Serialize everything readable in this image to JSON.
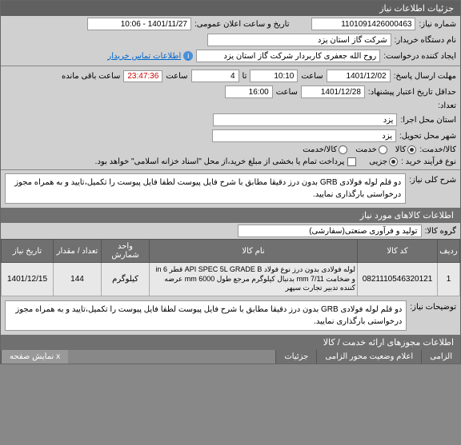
{
  "panel_title": "جزئیات اطلاعات نیاز",
  "labels": {
    "need_no": "شماره نیاز:",
    "announce": "تاریخ و ساعت اعلان عمومی:",
    "buyer": "نام دستگاه خریدار:",
    "requester": "ایجاد کننده درخواست:",
    "contact": "اطلاعات تماس خریدار",
    "deadline": "مهلت ارسال پاسخ:",
    "time_lbl": "ساعت",
    "until": "تا",
    "remaining": "ساعت باقی مانده",
    "min_credit": "حداقل تاریخ اعتبار پیشنهاد:",
    "price": "تعداد:",
    "exec_province": "استان محل اجرا:",
    "delivery_city": "شهر محل تحویل:",
    "goods_service": "کالا/خدمت:",
    "buy_type": "نوع فرآیند خرید :",
    "partial": "جزیی",
    "pay_note": "پرداخت تمام یا بخشی از مبلغ خرید،از محل \"اسناد خزانه اسلامی\" خواهد بود.",
    "need_title": "شرح کلی نیاز:",
    "goods_group": "گروه کالا:",
    "explanations": "توضیحات نیاز:"
  },
  "values": {
    "need_no": "1101091426000463",
    "announce": "1401/11/27 - 10:06",
    "buyer": "شرکت گاز استان یزد",
    "requester": "روح الله جعفری کاربردار شرکت گاز استان یزد",
    "deadline_date": "1401/12/02",
    "deadline_time": "10:10",
    "until_val": "4",
    "countdown": "23:47:36",
    "min_credit_date": "1401/12/28",
    "min_credit_time": "16:00",
    "exec_province": "یزد",
    "delivery_city": "یزد",
    "gs_goods": "کالا",
    "gs_service": "خدمت",
    "gs_both": "کالا/خدمت",
    "need_title": "دو قلم لوله فولادی GRB بدون درز دقیقا مطابق با شرح فایل پیوست لطفا فایل پیوست را تکمیل،تایید و به همراه مجوز درخواستی بارگذاری نمایید.",
    "goods_group": "تولید و فرآوری صنعتی(سفارشی)",
    "explanations": "دو قلم لوله فولادی GRB بدون درز دقیقا مطابق با شرح فایل پیوست لطفا فایل پیوست را تکمیل،تایید و به همراه مجوز درخواستی بارگذاری نمایید."
  },
  "sections": {
    "goods_info": "اطلاعات کالاهای مورد نیاز",
    "service_permits": "اطلاعات مجوزهای ارائه خدمت / کالا"
  },
  "table": {
    "headers": [
      "ردیف",
      "کد کالا",
      "نام کالا",
      "واحد شمارش",
      "تعداد / مقدار",
      "تاریخ نیاز"
    ],
    "rows": [
      {
        "n": "1",
        "code": "0821110546320121",
        "name": "لوله فولادی بدون درز نوع فولاد API SPEC 5L GRADE B قطر in 6 و ضخامت mm 7/11 بدنبال کیلوگرم مرجع طول mm 6000 عرضه کننده تدبیر تجارت سپهر",
        "unit": "کیلوگرم",
        "qty": "144",
        "date": "1401/12/15"
      }
    ]
  },
  "svc_tabs": [
    "الزامی",
    "اعلام وضعیت محور الزامی",
    "جزئیات"
  ],
  "svc_hint": "x نمایش صفحه"
}
